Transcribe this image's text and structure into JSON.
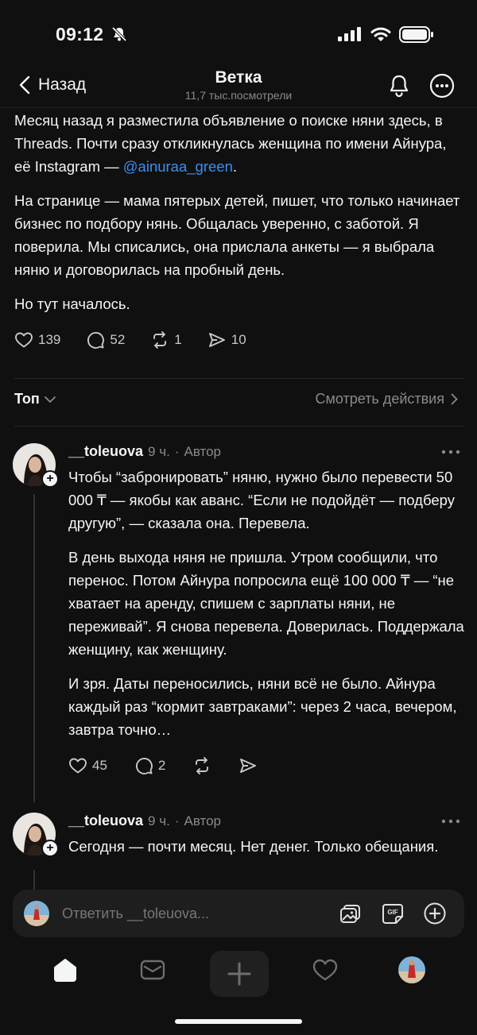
{
  "status": {
    "time": "09:12"
  },
  "header": {
    "back_label": "Назад",
    "title": "Ветка",
    "subtitle": "11,7 тыс.посмотрели"
  },
  "post": {
    "para1_before": "Месяц назад я разместила объявление о поиске няни здесь, в Threads. Почти сразу откликнулась женщина по имени Айнура, её Instagram — ",
    "mention": "@ainuraa_green",
    "para1_after": ".",
    "para2": "На странице — мама пятерых детей, пишет, что только начинает бизнес по подбору нянь. Общалась уверенно, с заботой. Я поверила. Мы списались, она прислала анкеты — я выбрала няню и договорилась на пробный день.",
    "para3": "Но тут началось.",
    "likes": "139",
    "comments": "52",
    "reposts": "1",
    "shares": "10"
  },
  "filter": {
    "sort_label": "Топ",
    "see_actions": "Смотреть действия"
  },
  "comments": [
    {
      "user": "__toleuova",
      "time": "9 ч.",
      "sep": "·",
      "role": "Автор",
      "paragraphs": [
        "Чтобы “забронировать” няню, нужно было перевести 50 000 ₸ — якобы как аванс. “Если не подойдёт — подберу другую”, — сказала она. Перевела.",
        "В день выхода няня не пришла. Утром сообщили, что перенос. Потом Айнура попросила ещё 100 000 ₸ — “не хватает на аренду, спишем с зарплаты няни, не переживай”. Я снова перевела. Доверилась. Поддержала женщину, как женщину.",
        "И зря. Даты переносились, няни всё не было. Айнура каждый раз “кормит завтраками”: через 2 часа, вечером, завтра точно…"
      ],
      "likes": "45",
      "replies": "2"
    },
    {
      "user": "__toleuova",
      "time": "9 ч.",
      "sep": "·",
      "role": "Автор",
      "paragraphs": [
        "Сегодня — почти месяц. Нет денег. Только обещания."
      ]
    }
  ],
  "reply_bar": {
    "placeholder": "Ответить __toleuova..."
  },
  "tabs": [
    "home-icon",
    "inbox-icon",
    "create-icon",
    "activity-icon",
    "profile-avatar"
  ],
  "colors": {
    "background": "#101010",
    "text": "#f3f5f7",
    "muted": "#8a8a8a",
    "link": "#3d8ef0"
  }
}
